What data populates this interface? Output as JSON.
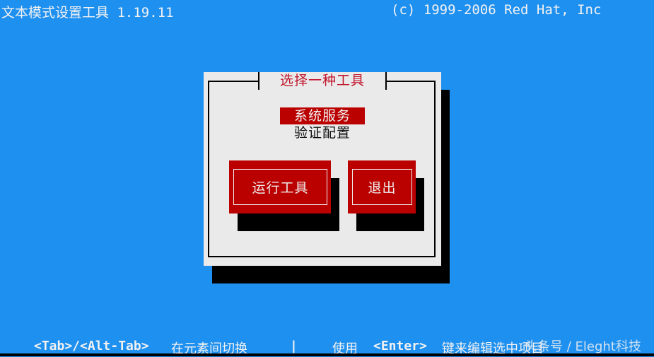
{
  "header": {
    "app_title": "文本模式设置工具 1.19.11",
    "copyright": "(c) 1999-2006 Red Hat, Inc"
  },
  "dialog": {
    "title": "选择一种工具",
    "list": {
      "items": [
        {
          "label": "系统服务",
          "selected": true
        },
        {
          "label": "验证配置",
          "selected": false
        }
      ]
    },
    "buttons": {
      "run_tool": "运行工具",
      "quit": "退出"
    }
  },
  "footer": {
    "hint_keys_1": "<Tab>/<Alt-Tab>",
    "hint_text_1": "在元素间切换",
    "separator": "|",
    "hint_prefix_2": "使用",
    "hint_keys_2": "<Enter>",
    "hint_text_2": "键来编辑选中项目",
    "watermark": "头条号 / Eleght科技"
  },
  "colors": {
    "background": "#1e90f0",
    "dialog_bg": "#eaeaea",
    "accent_red": "#bb0000",
    "title_red": "#c0142a"
  }
}
